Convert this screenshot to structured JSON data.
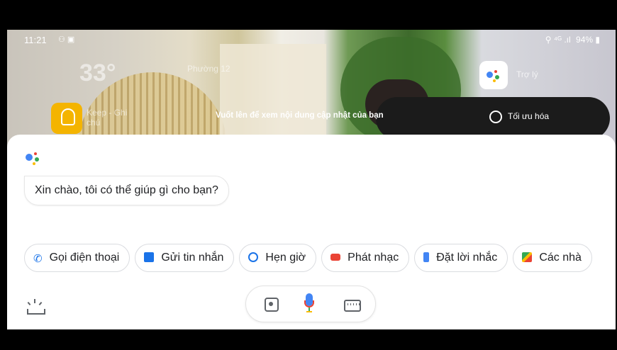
{
  "status_bar": {
    "time": "11:21",
    "notification_icons": "⚇ ▣",
    "right_icons": "⚲ ⁴ᴳ .ıl",
    "battery": "94%"
  },
  "home": {
    "weather_temp": "33°",
    "weather_location": "Phường 12",
    "keep_label": "Keep - Ghi chú",
    "assistant_app_label": "Trợ lý",
    "swipe_hint": "Vuốt lên để xem nội dung cập nhật của bạn",
    "optimize_label": "Tối ưu hóa"
  },
  "assistant": {
    "greeting": "Xin chào, tôi có thể giúp gì cho bạn?",
    "suggestions": [
      {
        "label": "Gọi điện thoại",
        "icon": "phone-icon"
      },
      {
        "label": "Gửi tin nhắn",
        "icon": "message-icon"
      },
      {
        "label": "Hẹn giờ",
        "icon": "timer-icon"
      },
      {
        "label": "Phát nhạc",
        "icon": "youtube-icon"
      },
      {
        "label": "Đặt lời nhắc",
        "icon": "reminder-icon"
      },
      {
        "label": "Các nhà",
        "icon": "maps-icon"
      }
    ],
    "input_bar": {
      "lens": "lens-icon",
      "mic": "mic-icon",
      "keyboard": "keyboard-icon"
    },
    "explore": "sunrise-icon",
    "colors": {
      "blue": "#4285f4",
      "red": "#ea4335",
      "yellow": "#fbbc05",
      "green": "#34a853"
    }
  }
}
